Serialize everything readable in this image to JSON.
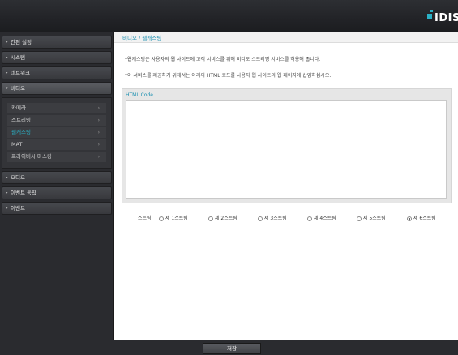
{
  "brand": {
    "logo_text": "IDIS"
  },
  "sidebar": {
    "items_top": [
      {
        "label": "간편 설정"
      },
      {
        "label": "시스템"
      },
      {
        "label": "네트워크"
      }
    ],
    "active": {
      "label": "비디오"
    },
    "submenu": [
      {
        "label": "카메라"
      },
      {
        "label": "스트리밍"
      },
      {
        "label": "웹캐스팅"
      },
      {
        "label": "MAT"
      },
      {
        "label": "프라이버시 마스킹"
      }
    ],
    "items_bottom": [
      {
        "label": "오디오"
      },
      {
        "label": "이벤트 동작"
      },
      {
        "label": "이벤트"
      }
    ]
  },
  "main": {
    "breadcrumb": "비디오 / 웹캐스팅",
    "desc1": "*웹캐스팅은 사용자의 웹 사이트에 고객 서비스를 위해 비디오 스트리밍 서비스를 허용해 줍니다.",
    "desc2": "*이 서비스를 제공하기 위해서는 아래의 HTML 코드를 사용자 웹 사이트의 웹 페이지에 삽입하십시오.",
    "html_code_label": "HTML Code",
    "html_code_value": "",
    "stream_label": "스트림",
    "streams": [
      {
        "label": "제 1스트림"
      },
      {
        "label": "제 2스트림"
      },
      {
        "label": "제 3스트림"
      },
      {
        "label": "제 4스트림"
      },
      {
        "label": "제 5스트림"
      },
      {
        "label": "제 6스트림"
      }
    ],
    "selected_stream": "제 6스트림"
  },
  "footer": {
    "save_label": "저장"
  },
  "colors": {
    "accent": "#2ab1c6",
    "link": "#1a8fb0"
  }
}
